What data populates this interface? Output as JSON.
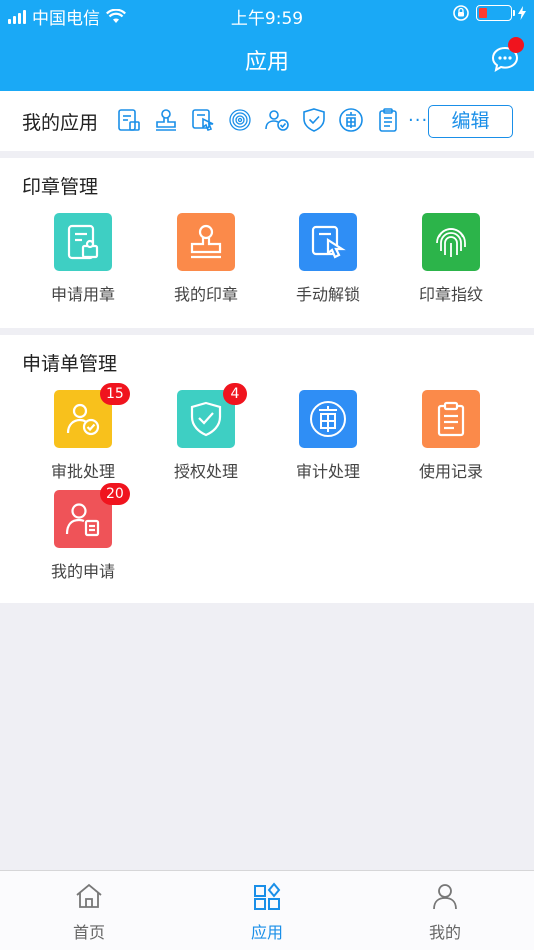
{
  "status_bar": {
    "carrier": "中国电信",
    "time": "上午9:59"
  },
  "nav": {
    "title": "应用",
    "message_icon": "chat-bubble-icon"
  },
  "my_apps": {
    "title": "我的应用",
    "icons": [
      "apply-seal-icon",
      "my-seal-icon",
      "manual-unlock-icon",
      "fingerprint-icon",
      "approve-icon",
      "authorize-icon",
      "audit-icon",
      "clipboard-icon"
    ],
    "more": "...",
    "edit_label": "编辑"
  },
  "seal_section": {
    "title": "印章管理",
    "items": [
      {
        "label": "申请用章",
        "icon": "apply-seal-icon",
        "color": "#3ecfc3"
      },
      {
        "label": "我的印章",
        "icon": "my-seal-icon",
        "color": "#fb8a4a"
      },
      {
        "label": "手动解锁",
        "icon": "manual-unlock-icon",
        "color": "#2f8ef5"
      },
      {
        "label": "印章指纹",
        "icon": "fingerprint-icon",
        "color": "#2cb44a"
      }
    ]
  },
  "apply_section": {
    "title": "申请单管理",
    "items": [
      {
        "label": "审批处理",
        "icon": "approve-icon",
        "color": "#f8c11c",
        "badge": "15"
      },
      {
        "label": "授权处理",
        "icon": "authorize-icon",
        "color": "#3ecfc3",
        "badge": "4"
      },
      {
        "label": "审计处理",
        "icon": "audit-icon",
        "color": "#2f8ef5"
      },
      {
        "label": "使用记录",
        "icon": "clipboard-icon",
        "color": "#fb8a4a"
      },
      {
        "label": "我的申请",
        "icon": "my-application-icon",
        "color": "#ef5358",
        "badge": "20"
      }
    ]
  },
  "tabbar": {
    "tabs": [
      {
        "label": "首页",
        "icon": "home-icon"
      },
      {
        "label": "应用",
        "icon": "apps-icon",
        "active": true
      },
      {
        "label": "我的",
        "icon": "profile-icon"
      }
    ]
  },
  "colors": {
    "header": "#1aa9f6",
    "accent": "#1a8fe8",
    "badge": "#f0141e"
  }
}
